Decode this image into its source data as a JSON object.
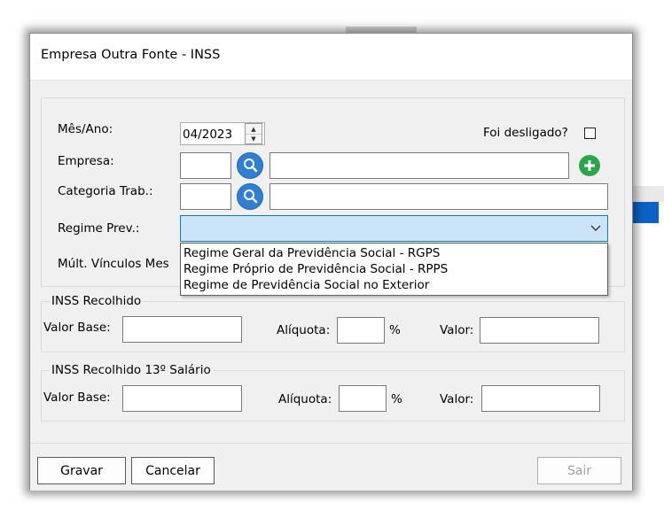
{
  "dialog": {
    "title": "Empresa Outra Fonte - INSS"
  },
  "form": {
    "mes_ano_label": "Mês/Ano:",
    "mes_ano_value": "04/2023",
    "foi_desligado_label": "Foi desligado?",
    "empresa_label": "Empresa:",
    "empresa_code": "",
    "empresa_name": "",
    "categoria_label": "Categoria Trab.:",
    "categoria_code": "",
    "categoria_name": "",
    "regime_label": "Regime Prev.:",
    "regime_value": "",
    "mult_vinculos_label": "Múlt. Vínculos Mes"
  },
  "regime_options": [
    "Regime Geral da Previdência Social - RGPS",
    "Regime Próprio de Previdência Social - RPPS",
    "Regime de Previdência Social no Exterior"
  ],
  "inss": {
    "title": "INSS Recolhido",
    "valor_base_label": "Valor Base:",
    "aliquota_label": "Alíquota:",
    "percent": "%",
    "valor_label": "Valor:"
  },
  "inss13": {
    "title": "INSS Recolhido 13º Salário",
    "valor_base_label": "Valor Base:",
    "aliquota_label": "Alíquota:",
    "percent": "%",
    "valor_label": "Valor:"
  },
  "buttons": {
    "gravar": "Gravar",
    "cancelar": "Cancelar",
    "sair": "Sair"
  },
  "colors": {
    "lookup_blue": "#2f7fd4",
    "add_green": "#2aa64a",
    "combo_focus": "#cce4f7",
    "focus_border": "#0a78d7"
  }
}
